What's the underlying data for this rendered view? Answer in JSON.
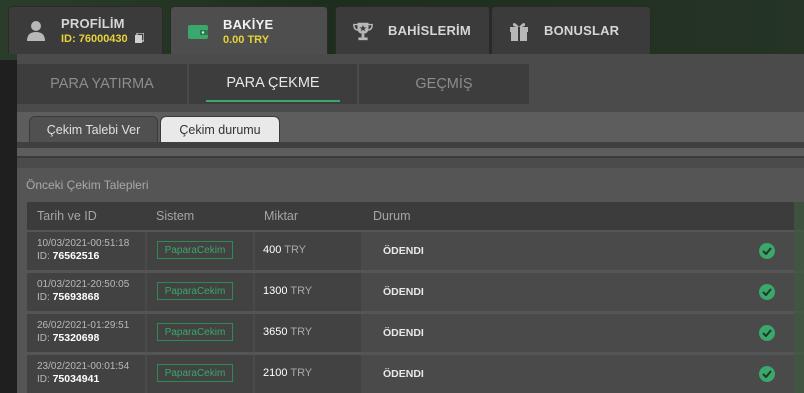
{
  "nav": {
    "tabs": [
      {
        "label": "PROFİLİM",
        "sub": "ID: 76000430",
        "icon": "user-icon"
      },
      {
        "label": "BAKİYE",
        "sub": "0.00 TRY",
        "icon": "wallet-icon"
      },
      {
        "label": "BAHİSLERİM",
        "icon": "trophy-icon"
      },
      {
        "label": "BONUSLAR",
        "icon": "gift-icon"
      }
    ]
  },
  "subtabs": [
    "PARA YATIRMA",
    "PARA ÇEKME",
    "GEÇMİŞ"
  ],
  "innertabs": [
    "Çekim Talebi Ver",
    "Çekim durumu"
  ],
  "section": {
    "title": "Önceki Çekim Talepleri",
    "headers": [
      "Tarih ve ID",
      "Sistem",
      "Miktar",
      "Durum"
    ],
    "rows": [
      {
        "date": "10/03/2021-00:51:18",
        "id_label": "ID: ",
        "id": "76562516",
        "system": "PaparaCekim",
        "amount": "400",
        "currency": "TRY",
        "status": "ÖDENDI"
      },
      {
        "date": "01/03/2021-20:50:05",
        "id_label": "ID: ",
        "id": "75693868",
        "system": "PaparaCekim",
        "amount": "1300",
        "currency": "TRY",
        "status": "ÖDENDI"
      },
      {
        "date": "26/02/2021-01:29:51",
        "id_label": "ID: ",
        "id": "75320698",
        "system": "PaparaCekim",
        "amount": "3650",
        "currency": "TRY",
        "status": "ÖDENDI"
      },
      {
        "date": "23/02/2021-00:01:54",
        "id_label": "ID: ",
        "id": "75034941",
        "system": "PaparaCekim",
        "amount": "2100",
        "currency": "TRY",
        "status": "ÖDENDI"
      }
    ]
  },
  "colors": {
    "accent": "#3aa76b",
    "balance": "#e6d23a"
  }
}
